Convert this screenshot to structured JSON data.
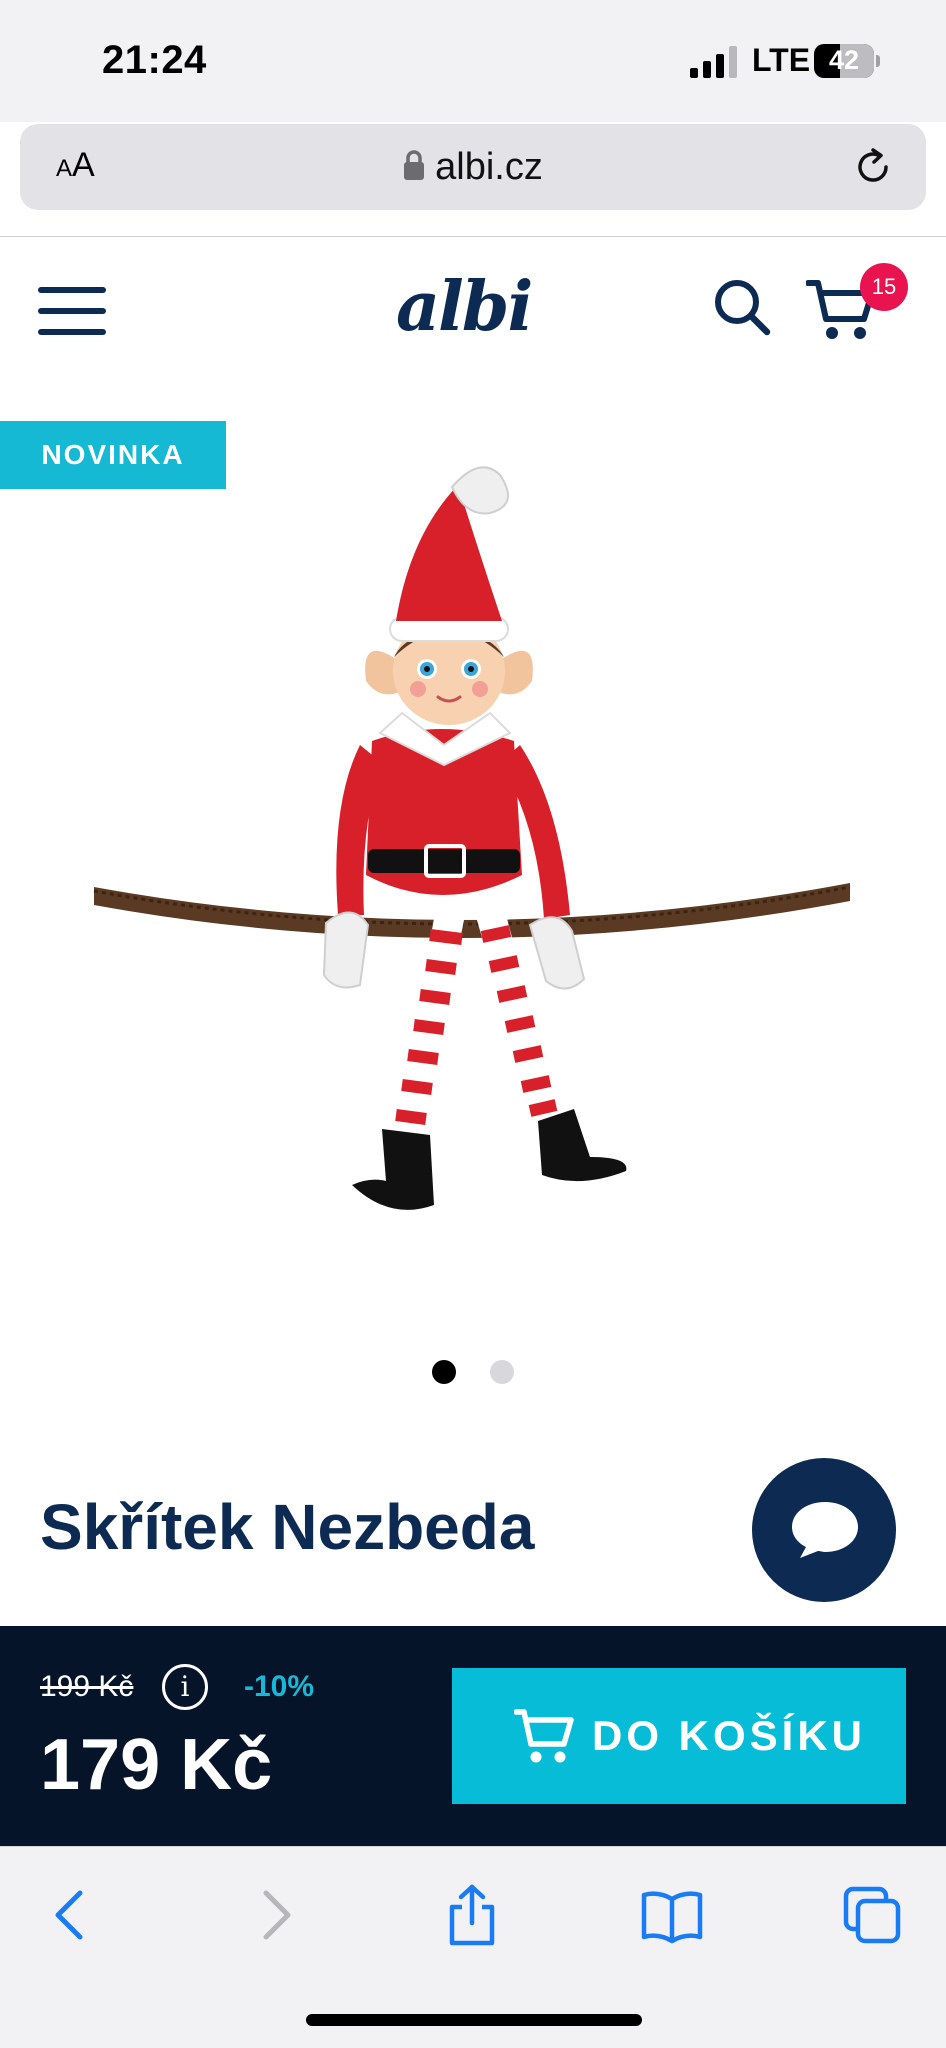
{
  "status_bar": {
    "time": "21:24",
    "network": "LTE",
    "battery": "42"
  },
  "browser": {
    "aa_small": "A",
    "aa_big": "A",
    "url": "albi.cz"
  },
  "header": {
    "logo": "albi",
    "cart_count": "15"
  },
  "product": {
    "badge": "NOVINKA",
    "title": "Skřítek Nezbeda",
    "gallery": {
      "total_images": 2,
      "active_index": 0
    }
  },
  "buy_bar": {
    "old_price": "199 Kč",
    "info_symbol": "i",
    "discount": "-10%",
    "price": "179 Kč",
    "add_to_cart_label": "DO KOŠÍKU"
  },
  "colors": {
    "brand_navy": "#0c2a52",
    "accent_cyan": "#07bcd6",
    "badge_pink": "#e8134f",
    "buy_bar_bg": "#061429",
    "ios_blue": "#1a7cf5"
  },
  "icons": [
    "menu-icon",
    "search-icon",
    "cart-icon",
    "chat-icon",
    "back-icon",
    "forward-icon",
    "share-icon",
    "bookmarks-icon",
    "tabs-icon",
    "lock-icon",
    "reload-icon",
    "info-icon"
  ]
}
